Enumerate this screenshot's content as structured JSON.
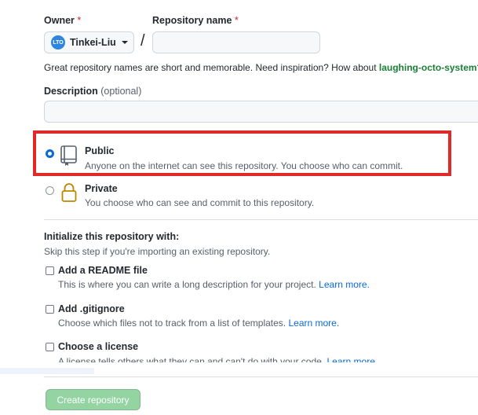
{
  "owner": {
    "label": "Owner",
    "required_mark": "*",
    "value": "Tinkei-Liu",
    "avatar_text": "LTO"
  },
  "repo_name": {
    "label": "Repository name",
    "required_mark": "*",
    "value": "",
    "separator": "/"
  },
  "suggestion": {
    "text": "Great repository names are short and memorable. Need inspiration? How about ",
    "name": "laughing-octo-system",
    "suffix": "?"
  },
  "description": {
    "label": "Description",
    "optional": "(optional)",
    "value": ""
  },
  "visibility": {
    "public": {
      "title": "Public",
      "desc": "Anyone on the internet can see this repository. You choose who can commit.",
      "selected": true
    },
    "private": {
      "title": "Private",
      "desc": "You choose who can see and commit to this repository.",
      "selected": false
    }
  },
  "init": {
    "heading": "Initialize this repository with:",
    "subheading": "Skip this step if you're importing an existing repository.",
    "readme": {
      "title": "Add a README file",
      "desc": "This is where you can write a long description for your project.",
      "link": "Learn more."
    },
    "gitignore": {
      "title": "Add .gitignore",
      "desc": "Choose which files not to track from a list of templates.",
      "link": "Learn more."
    },
    "license": {
      "title": "Choose a license",
      "desc": "A license tells others what they can and can't do with your code.",
      "link": "Learn more."
    }
  },
  "create_button": "Create repository",
  "colors": {
    "accent": "#0969da",
    "highlight": "#e02a2a",
    "suggestion_green": "#1a7f37",
    "create_button_bg": "#94d3a2"
  }
}
